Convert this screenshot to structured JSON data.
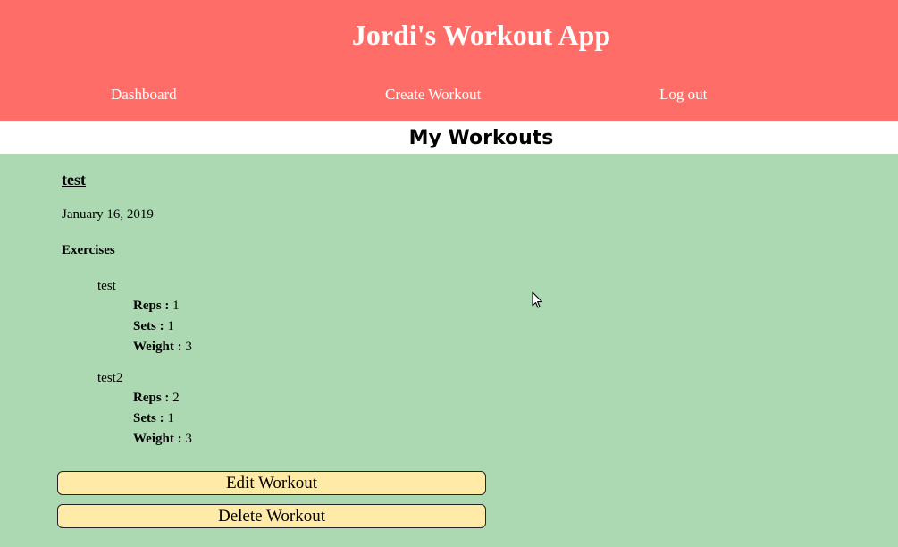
{
  "header": {
    "title": "Jordi's Workout App",
    "nav": {
      "dashboard": "Dashboard",
      "create_workout": "Create Workout",
      "log_out": "Log out"
    }
  },
  "page": {
    "section_title": "My Workouts"
  },
  "workout": {
    "name": "test",
    "date": "January 16, 2019",
    "exercises_heading": "Exercises",
    "exercises": [
      {
        "name": "test",
        "reps_label": "Reps :",
        "reps": "1",
        "sets_label": "Sets :",
        "sets": "1",
        "weight_label": "Weight :",
        "weight": "3"
      },
      {
        "name": "test2",
        "reps_label": "Reps :",
        "reps": "2",
        "sets_label": "Sets :",
        "sets": "1",
        "weight_label": "Weight :",
        "weight": "3"
      }
    ],
    "edit_button": "Edit Workout",
    "delete_button": "Delete Workout"
  },
  "colors": {
    "header_bg": "#ff6d68",
    "content_bg": "#acd8b2",
    "button_bg": "#ffeaa8"
  },
  "icons": {
    "cursor": "mouse-pointer-icon"
  }
}
